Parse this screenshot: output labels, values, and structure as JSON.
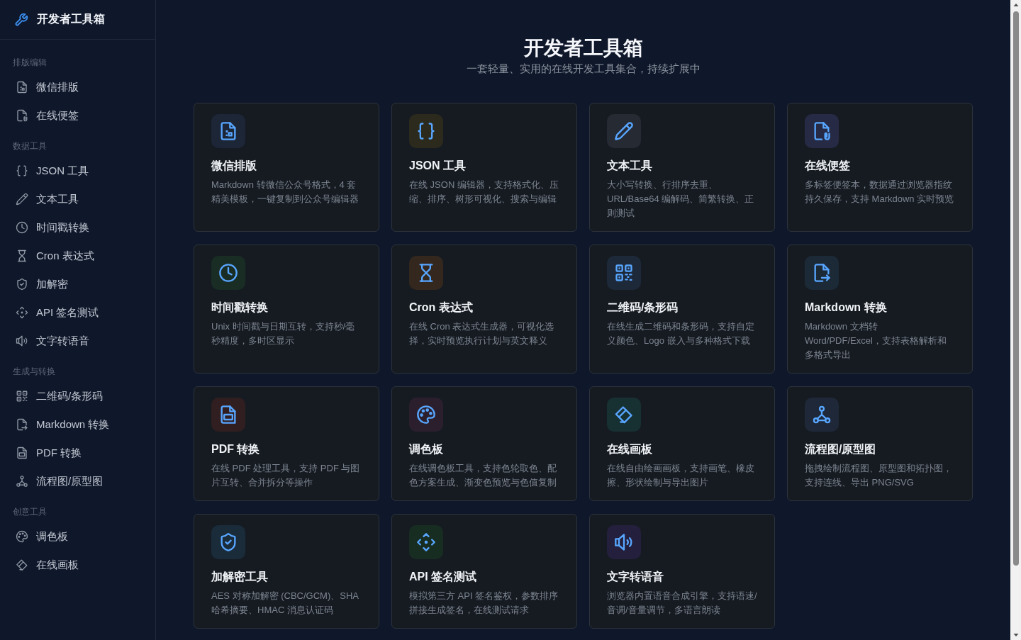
{
  "sidebar": {
    "title": "开发者工具箱",
    "groups": [
      {
        "label": "排版编辑",
        "items": [
          {
            "label": "微信排版",
            "kind": "wechat",
            "selected": false
          },
          {
            "label": "在线便签",
            "kind": "note",
            "selected": false
          }
        ]
      },
      {
        "label": "数据工具",
        "items": [
          {
            "label": "JSON 工具",
            "kind": "json",
            "selected": false
          },
          {
            "label": "文本工具",
            "kind": "text",
            "selected": false
          },
          {
            "label": "时间戳转换",
            "kind": "timestamp",
            "selected": false
          },
          {
            "label": "Cron 表达式",
            "kind": "cron",
            "selected": false
          },
          {
            "label": "加解密",
            "kind": "crypto",
            "selected": false
          },
          {
            "label": "API 签名测试",
            "kind": "api",
            "selected": false
          },
          {
            "label": "文字转语音",
            "kind": "tts",
            "selected": false
          }
        ]
      },
      {
        "label": "生成与转换",
        "items": [
          {
            "label": "二维码/条形码",
            "kind": "qrcode",
            "selected": false
          },
          {
            "label": "Markdown 转换",
            "kind": "markdown",
            "selected": false
          },
          {
            "label": "PDF 转换",
            "kind": "pdf",
            "selected": false
          },
          {
            "label": "流程图/原型图",
            "kind": "flowchart",
            "selected": false
          }
        ]
      },
      {
        "label": "创意工具",
        "items": [
          {
            "label": "调色板",
            "kind": "palette",
            "selected": false
          },
          {
            "label": "在线画板",
            "kind": "canvas",
            "selected": false
          }
        ]
      }
    ]
  },
  "header": {
    "title": "开发者工具箱",
    "subtitle": "一套轻量、实用的在线开发工具集合，持续扩展中"
  },
  "cards": [
    {
      "kind": "wechat",
      "color": "#1c2636",
      "title": "微信排版",
      "description": "Markdown 转微信公众号格式，4 套精美模板，一键复制到公众号编辑器"
    },
    {
      "kind": "json",
      "color": "#2b2a1d",
      "title": "JSON 工具",
      "description": "在线 JSON 编辑器，支持格式化、压缩、排序、树形可视化、搜索与编辑"
    },
    {
      "kind": "text",
      "color": "#252a33",
      "title": "文本工具",
      "description": "大小写转换、行排序去重、URL/Base64 编解码、简繁转换、正则测试"
    },
    {
      "kind": "note",
      "color": "#262a45",
      "title": "在线便签",
      "description": "多标签便签本，数据通过浏览器指纹持久保存，支持 Markdown 实时预览"
    },
    {
      "kind": "timestamp",
      "color": "#192d24",
      "title": "时间戳转换",
      "description": "Unix 时间戳与日期互转，支持秒/毫秒精度，多时区显示"
    },
    {
      "kind": "cron",
      "color": "#33271e",
      "title": "Cron 表达式",
      "description": "在线 Cron 表达式生成器，可视化选择，实时预览执行计划与英文释义"
    },
    {
      "kind": "qrcode",
      "color": "#1d2838",
      "title": "二维码/条形码",
      "description": "在线生成二维码和条形码，支持自定义颜色、Logo 嵌入与多种格式下载"
    },
    {
      "kind": "markdown",
      "color": "#1c2a38",
      "title": "Markdown 转换",
      "description": "Markdown 文档转 Word/PDF/Excel，支持表格解析和多格式导出"
    },
    {
      "kind": "pdf",
      "color": "#301e20",
      "title": "PDF 转换",
      "description": "在线 PDF 处理工具，支持 PDF 与图片互转、合并拆分等操作"
    },
    {
      "kind": "palette",
      "color": "#2b1f2e",
      "title": "调色板",
      "description": "在线调色板工具，支持色轮取色、配色方案生成、渐变色预览与色值复制"
    },
    {
      "kind": "canvas",
      "color": "#173032",
      "title": "在线画板",
      "description": "在线自由绘画画板，支持画笔、橡皮擦、形状绘制与导出图片"
    },
    {
      "kind": "flowchart",
      "color": "#1e2838",
      "title": "流程图/原型图",
      "description": "拖拽绘制流程图、原型图和拓扑图，支持连线、导出 PNG/SVG"
    },
    {
      "kind": "crypto",
      "color": "#1a2b3a",
      "title": "加解密工具",
      "description": "AES 对称加解密 (CBC/GCM)、SHA 哈希摘要、HMAC 消息认证码"
    },
    {
      "kind": "api",
      "color": "#182d22",
      "title": "API 签名测试",
      "description": "模拟第三方 API 签名鉴权，参数排序拼接生成签名，在线测试请求"
    },
    {
      "kind": "tts",
      "color": "#241f3c",
      "title": "文字转语音",
      "description": "浏览器内置语音合成引擎，支持语速/音调/音量调节，多语言朗读"
    }
  ]
}
